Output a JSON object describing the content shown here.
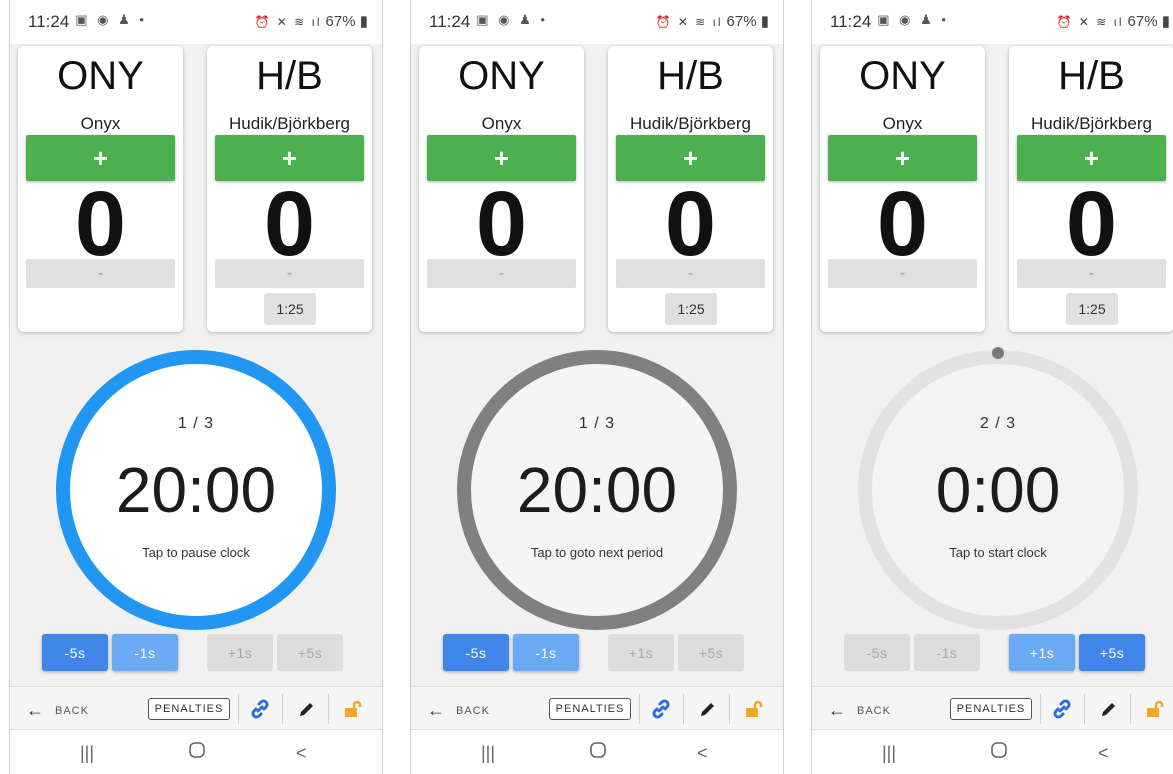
{
  "colors": {
    "plus_green": "#4caf50",
    "ring_running": "#2196f3",
    "ring_paused": "#808080",
    "ring_stopped": "#e2e2e2",
    "link_blue": "#2b6fd6",
    "lock_orange": "#f5a623"
  },
  "screens": [
    {
      "status": {
        "time": "11:24",
        "battery": "67%"
      },
      "home": {
        "abbr": "ONY",
        "name": "Onyx",
        "plus": "+",
        "score": "0",
        "minus": "-"
      },
      "away": {
        "abbr": "H/B",
        "name": "Hudik/Björkberg",
        "plus": "+",
        "score": "0",
        "minus": "-",
        "penalty": "1:25"
      },
      "clock": {
        "period": "1 / 3",
        "time": "20:00",
        "hint": "Tap to pause clock",
        "ring_state": "running"
      },
      "adjust": {
        "minus5": "-5s",
        "minus1": "-1s",
        "plus1": "+1s",
        "plus5": "+5s"
      },
      "toolbar": {
        "back": "BACK",
        "penalties": "PENALTIES"
      }
    },
    {
      "status": {
        "time": "11:24",
        "battery": "67%"
      },
      "home": {
        "abbr": "ONY",
        "name": "Onyx",
        "plus": "+",
        "score": "0",
        "minus": "-"
      },
      "away": {
        "abbr": "H/B",
        "name": "Hudik/Björkberg",
        "plus": "+",
        "score": "0",
        "minus": "-",
        "penalty": "1:25"
      },
      "clock": {
        "period": "1 / 3",
        "time": "20:00",
        "hint": "Tap to goto next period",
        "ring_state": "paused"
      },
      "adjust": {
        "minus5": "-5s",
        "minus1": "-1s",
        "plus1": "+1s",
        "plus5": "+5s"
      },
      "toolbar": {
        "back": "BACK",
        "penalties": "PENALTIES"
      }
    },
    {
      "status": {
        "time": "11:24",
        "battery": "67%"
      },
      "home": {
        "abbr": "ONY",
        "name": "Onyx",
        "plus": "+",
        "score": "0",
        "minus": "-"
      },
      "away": {
        "abbr": "H/B",
        "name": "Hudik/Björkberg",
        "plus": "+",
        "score": "0",
        "minus": "-",
        "penalty": "1:25"
      },
      "clock": {
        "period": "2 / 3",
        "time": "0:00",
        "hint": "Tap to start clock",
        "ring_state": "stopped"
      },
      "adjust": {
        "minus5": "-5s",
        "minus1": "-1s",
        "plus1": "+1s",
        "plus5": "+5s"
      },
      "toolbar": {
        "back": "BACK",
        "penalties": "PENALTIES"
      }
    }
  ]
}
